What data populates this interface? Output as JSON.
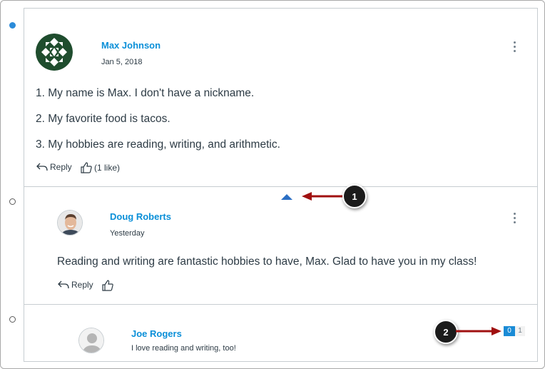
{
  "posts": [
    {
      "author": "Max Johnson",
      "date": "Jan 5, 2018",
      "lines": [
        "1. My name is Max. I don't have a nickname.",
        "2. My favorite food is tacos.",
        "3. My hobbies are reading, writing, and arithmetic."
      ],
      "reply_label": "Reply",
      "like_label": "(1 like)"
    },
    {
      "author": "Doug Roberts",
      "date": "Yesterday",
      "body": "Reading and writing are fantastic hobbies to have, Max. Glad to have you in my class!",
      "reply_label": "Reply"
    },
    {
      "author": "Joe Rogers",
      "body": "I love reading and writing, too!",
      "unread_count": "0",
      "total_count": "1"
    }
  ],
  "callouts": [
    "1",
    "2"
  ],
  "colors": {
    "link": "#0a8fd8",
    "unread_dot": "#2b8bd9",
    "collapse_arrow": "#2b6fc4",
    "callout_arrow": "#a01010",
    "badge_blue": "#1a8bd6"
  },
  "icons": {
    "kebab": "more-vertical-icon",
    "reply": "reply-arrow-icon",
    "like": "thumbs-up-icon",
    "collapse": "caret-up-icon"
  }
}
